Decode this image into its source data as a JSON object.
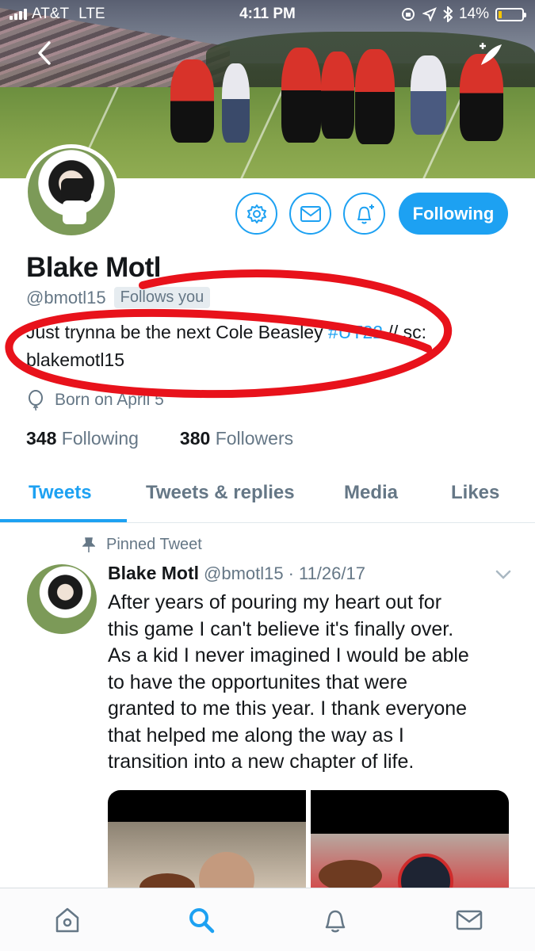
{
  "status_bar": {
    "carrier": "AT&T",
    "network": "LTE",
    "time": "4:11 PM",
    "battery_percent": "14%",
    "battery_level": 0.14,
    "icons": [
      "signal-bars-icon",
      "lock-rotation-icon",
      "location-arrow-icon",
      "bluetooth-icon",
      "battery-icon"
    ]
  },
  "header": {
    "back_icon": "chevron-left-icon",
    "compose_icon": "compose-tweet-icon"
  },
  "profile": {
    "name": "Blake Motl",
    "handle": "@bmotl15",
    "follows_you": "Follows you",
    "bio_prefix": "Just trynna be the next Cole Beasley ",
    "bio_hashtag": "#UT22",
    "bio_suffix": " // sc:",
    "bio_line2": "blakemotl15",
    "born": "Born on April 5",
    "following_count": "348",
    "following_label": "Following",
    "followers_count": "380",
    "followers_label": "Followers"
  },
  "actions": {
    "settings_icon": "gear-icon",
    "message_icon": "envelope-icon",
    "notify_icon": "bell-plus-icon",
    "follow_label": "Following"
  },
  "tabs": [
    {
      "label": "Tweets",
      "active": true
    },
    {
      "label": "Tweets & replies",
      "active": false
    },
    {
      "label": "Media",
      "active": false
    },
    {
      "label": "Likes",
      "active": false
    }
  ],
  "pinned_tweet": {
    "pinned_label": "Pinned Tweet",
    "author_name": "Blake Motl",
    "author_handle": "@bmotl15",
    "separator": "·",
    "date": "11/26/17",
    "lines": [
      "After years of pouring my heart out for",
      "this game I can't believe it's finally over.",
      "As a kid I never imagined I would be able",
      "to have the opportunites that were",
      "granted to me this year. I thank everyone",
      "that helped me along the way as I",
      "transition into a new chapter of life."
    ]
  },
  "bottom_nav": [
    {
      "icon": "home-icon",
      "active": false
    },
    {
      "icon": "search-icon",
      "active": true
    },
    {
      "icon": "bell-icon",
      "active": false
    },
    {
      "icon": "envelope-icon",
      "active": false
    }
  ],
  "colors": {
    "accent": "#1da1f2",
    "secondary_text": "#657786",
    "annotation_red": "#e8121b"
  }
}
